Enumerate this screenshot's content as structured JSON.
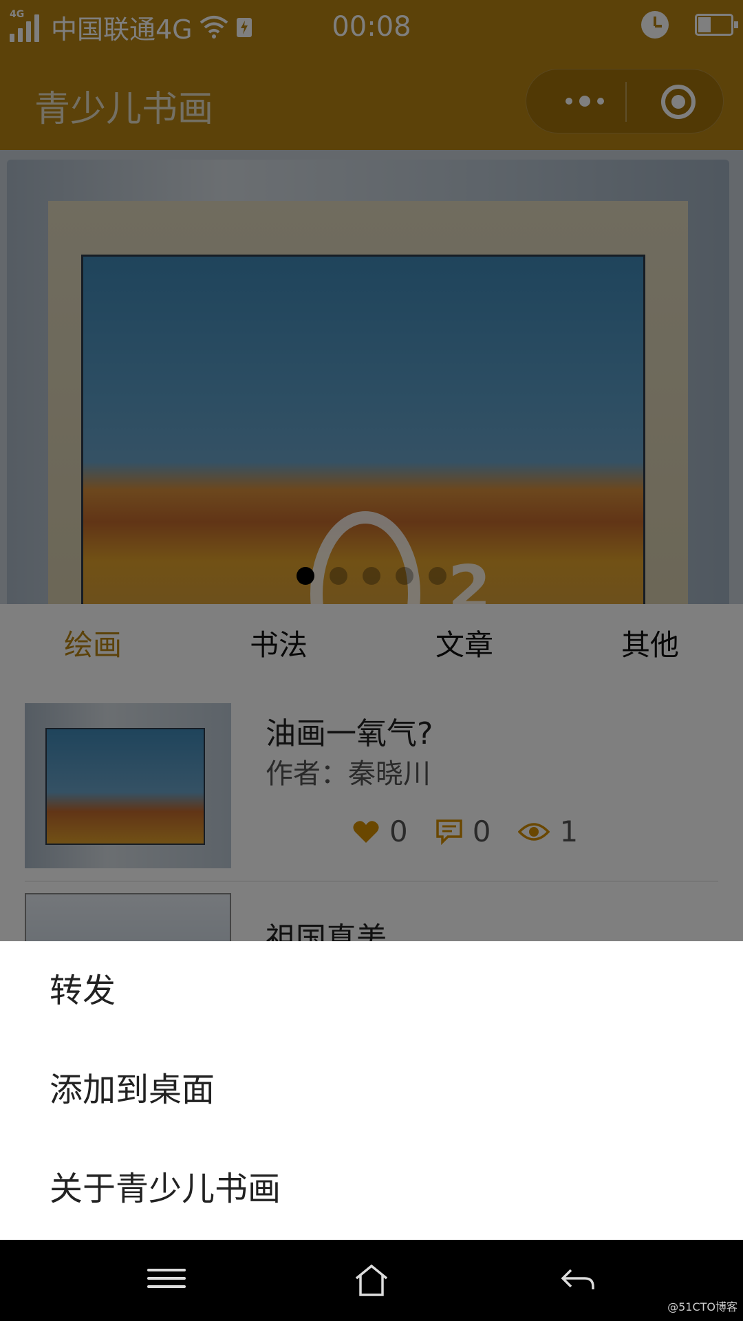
{
  "status_bar": {
    "network_tag": "4G",
    "carrier": "中国联通4G",
    "time": "00:08"
  },
  "nav": {
    "title": "青少儿书画"
  },
  "banner": {
    "dots_total": 5,
    "active_dot": 1
  },
  "tabs": [
    {
      "label": "绘画",
      "active": true
    },
    {
      "label": "书法",
      "active": false
    },
    {
      "label": "文章",
      "active": false
    },
    {
      "label": "其他",
      "active": false
    }
  ],
  "list": {
    "items": [
      {
        "title": "油画一氧气?",
        "author": "作者：秦晓川",
        "likes": "0",
        "comments": "0",
        "views": "1"
      },
      {
        "title": "祖国真美"
      }
    ]
  },
  "action_sheet": {
    "items": [
      "转发",
      "添加到桌面",
      "关于青少儿书画"
    ]
  },
  "watermark": "@51CTO博客",
  "colors": {
    "brand": "#b88412",
    "active_tab": "#b88412",
    "icon": "#d48e00"
  },
  "icons": {
    "like": "heart-icon",
    "comment": "comment-icon",
    "view": "eye-icon"
  }
}
